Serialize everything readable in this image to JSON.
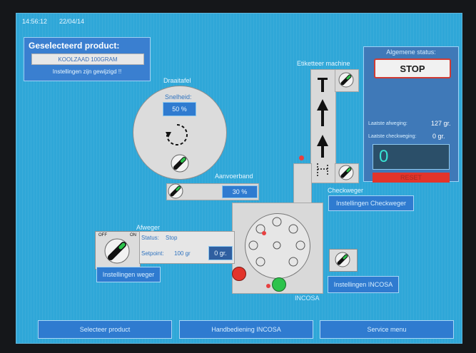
{
  "header": {
    "time": "14:56:12",
    "date": "22/04/14"
  },
  "product": {
    "title": "Geselecteerd product:",
    "name": "KOOLZAAD 100GRAM",
    "settings_warning": "Instellingen zijn gewijzigd !!"
  },
  "draaitafel": {
    "title": "Draaitafel",
    "speed_label": "Snelheid:",
    "speed_value": "50 %"
  },
  "aanvoerband": {
    "title": "Aanvoerband",
    "value": "30 %"
  },
  "etiketteer": {
    "title": "Etiketteer machine"
  },
  "status_panel": {
    "title": "Algemene status:",
    "stop_label": "STOP",
    "last_weigh_label": "Laatste afweging:",
    "last_weigh_value": "127 gr.",
    "last_check_label": "Laatste checkweging:",
    "last_check_value": "0 gr.",
    "counter": "0",
    "reset_label": "RESET"
  },
  "checkweger": {
    "title": "Checkweger",
    "settings_button": "Instellingen Checkweger"
  },
  "afweger": {
    "title": "Afweger",
    "status_label": "Status:",
    "status_value": "Stop",
    "setpoint_label": "Setpoint:",
    "setpoint_value": "100 gr",
    "weight_value": "0 gr.",
    "settings_button": "Instellingen weger",
    "switch_off": "OFF",
    "switch_on": "ON"
  },
  "incosa": {
    "title": "INCOSA",
    "settings_button": "Instellingen INCOSA"
  },
  "bottom_nav": {
    "select_product": "Selecteer product",
    "manual_incosa": "Handbediening INCOSA",
    "service_menu": "Service menu"
  },
  "colors": {
    "screen_bg": "#2fa7d8",
    "panel_blue": "#2b79c7",
    "status_bg": "#3f79b8",
    "reset_red": "#e2342b",
    "green": "#2cc34b"
  }
}
